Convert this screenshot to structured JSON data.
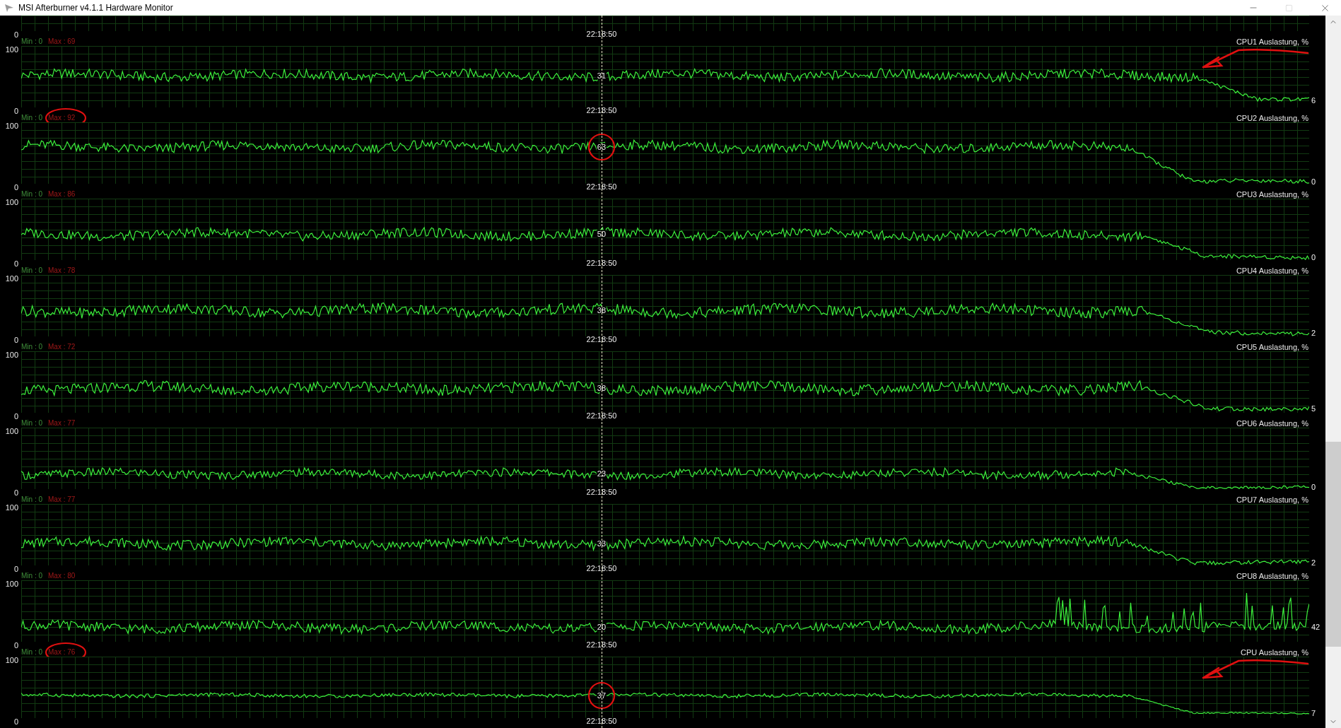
{
  "window": {
    "title": "MSI Afterburner v4.1.1 Hardware Monitor"
  },
  "panels": [
    {
      "axis_min": "0",
      "time": "22:18:50",
      "min": "Min : 0",
      "max": "Max : 69",
      "title": "CPU1 Auslastung, %",
      "axis_max": "100",
      "center_value": "31",
      "end_value": "6",
      "max_circled": false,
      "center_circled": false,
      "arrow": true
    },
    {
      "axis_min": "0",
      "time": "22:18:50",
      "min": "Min : 0",
      "max": "Max : 92",
      "title": "CPU2 Auslastung, %",
      "axis_max": "100",
      "center_value": "63",
      "end_value": "0",
      "max_circled": true,
      "center_circled": true,
      "arrow": false
    },
    {
      "axis_min": "0",
      "time": "22:18:50",
      "min": "Min : 0",
      "max": "Max : 86",
      "title": "CPU3 Auslastung, %",
      "axis_max": "100",
      "center_value": "50",
      "end_value": "0",
      "max_circled": false,
      "center_circled": false,
      "arrow": false
    },
    {
      "axis_min": "0",
      "time": "22:18:50",
      "min": "Min : 0",
      "max": "Max : 78",
      "title": "CPU4 Auslastung, %",
      "axis_max": "100",
      "center_value": "38",
      "end_value": "2",
      "max_circled": false,
      "center_circled": false,
      "arrow": false
    },
    {
      "axis_min": "0",
      "time": "22:18:50",
      "min": "Min : 0",
      "max": "Max : 72",
      "title": "CPU5 Auslastung, %",
      "axis_max": "100",
      "center_value": "38",
      "end_value": "5",
      "max_circled": false,
      "center_circled": false,
      "arrow": false
    },
    {
      "axis_min": "0",
      "time": "22:18:50",
      "min": "Min : 0",
      "max": "Max : 77",
      "title": "CPU6 Auslastung, %",
      "axis_max": "100",
      "center_value": "23",
      "end_value": "0",
      "max_circled": false,
      "center_circled": false,
      "arrow": false
    },
    {
      "axis_min": "0",
      "time": "22:18:50",
      "min": "Min : 0",
      "max": "Max : 77",
      "title": "CPU7 Auslastung, %",
      "axis_max": "100",
      "center_value": "33",
      "end_value": "2",
      "max_circled": false,
      "center_circled": false,
      "arrow": false
    },
    {
      "axis_min": "0",
      "time": "22:18:50",
      "min": "Min : 0",
      "max": "Max : 80",
      "title": "CPU8 Auslastung, %",
      "axis_max": "100",
      "center_value": "20",
      "end_value": "42",
      "max_circled": false,
      "center_circled": false,
      "arrow": false
    },
    {
      "axis_min": "0",
      "time": "22:18:50",
      "min": "Min : 0",
      "max": "Max : 76",
      "title": "CPU Auslastung, %",
      "axis_max": "100",
      "center_value": "37",
      "end_value": "7",
      "max_circled": true,
      "center_circled": true,
      "arrow": true
    }
  ],
  "footer": {
    "axis_min": "0",
    "time": "22:18:50"
  }
}
